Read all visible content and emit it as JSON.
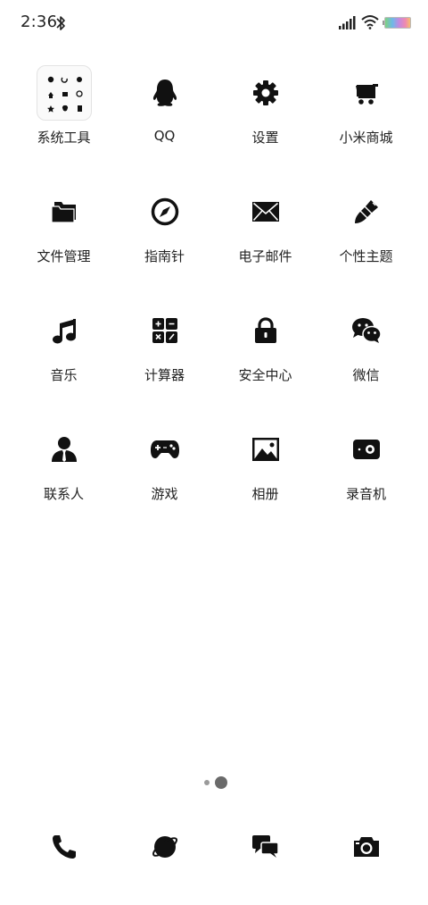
{
  "status_bar": {
    "time": "2:36",
    "icons": [
      "bluetooth-icon",
      "signal-icon",
      "wifi-icon",
      "battery-icon"
    ]
  },
  "apps": [
    {
      "label": "系统工具",
      "icon": "system-tools-folder-icon"
    },
    {
      "label": "QQ",
      "icon": "qq-penguin-icon"
    },
    {
      "label": "设置",
      "icon": "gear-icon"
    },
    {
      "label": "小米商城",
      "icon": "shopping-cart-icon"
    },
    {
      "label": "文件管理",
      "icon": "folder-icon"
    },
    {
      "label": "指南针",
      "icon": "compass-icon"
    },
    {
      "label": "电子邮件",
      "icon": "envelope-icon"
    },
    {
      "label": "个性主题",
      "icon": "paintbrush-icon"
    },
    {
      "label": "音乐",
      "icon": "music-note-icon"
    },
    {
      "label": "计算器",
      "icon": "calculator-icon"
    },
    {
      "label": "安全中心",
      "icon": "lock-icon"
    },
    {
      "label": "微信",
      "icon": "wechat-icon"
    },
    {
      "label": "联系人",
      "icon": "contact-person-icon"
    },
    {
      "label": "游戏",
      "icon": "gamepad-icon"
    },
    {
      "label": "相册",
      "icon": "picture-icon"
    },
    {
      "label": "录音机",
      "icon": "recorder-icon"
    }
  ],
  "page_indicator": {
    "pages": 2,
    "current": 2
  },
  "dock": [
    {
      "icon": "phone-icon"
    },
    {
      "icon": "planet-browser-icon"
    },
    {
      "icon": "chat-bubbles-icon"
    },
    {
      "icon": "camera-icon"
    }
  ],
  "colors": {
    "background": "#ffffff",
    "icon": "#111111",
    "text": "#222222"
  }
}
